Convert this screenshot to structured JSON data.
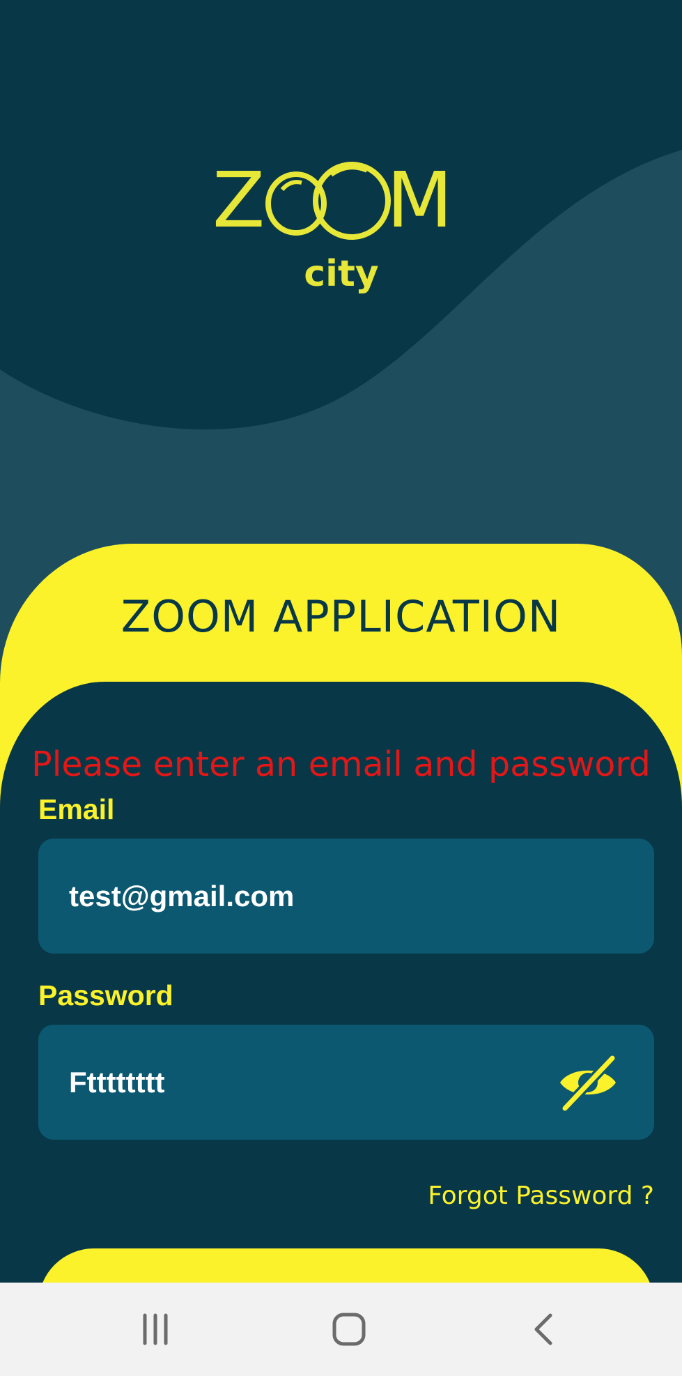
{
  "logo": {
    "word": "ZOOM",
    "sub": "city"
  },
  "app_title": "ZOOM APPLICATION",
  "error_message": "Please enter an email and password",
  "email": {
    "label": "Email",
    "value": "test@gmail.com"
  },
  "password": {
    "label": "Password",
    "value": "Ftttttttt",
    "visibility_icon": "eye-off-icon"
  },
  "forgot_password": "Forgot Password ?",
  "login_button": "",
  "colors": {
    "background": "#083747",
    "wave": "#1e4d5e",
    "accent": "#fbf22b",
    "field": "#0b5870",
    "error": "#e31717",
    "nav_bar": "#f2f2f2"
  },
  "nav": {
    "recent": "recent-apps-icon",
    "home": "home-icon",
    "back": "back-icon"
  }
}
